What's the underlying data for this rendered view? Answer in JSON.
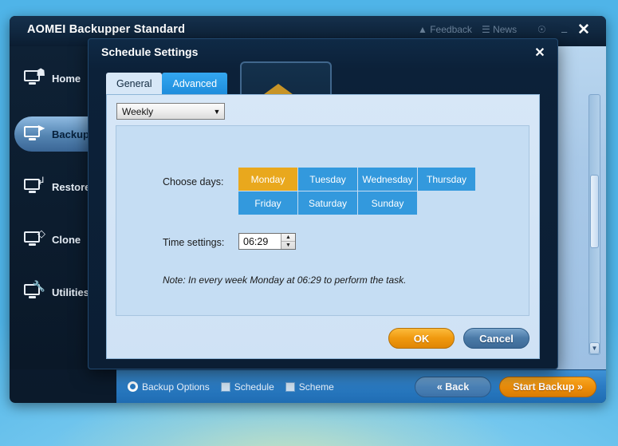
{
  "app": {
    "title": "AOMEI Backupper Standard",
    "close_label": "✕",
    "minimize_label": "–",
    "toolbar_icons": [
      "feedback-icon",
      "news-icon",
      "help-icon"
    ]
  },
  "sidebar": {
    "items": [
      {
        "label": "Home",
        "icon": "monitor-home-icon",
        "active": false
      },
      {
        "label": "Backup",
        "icon": "monitor-backup-icon",
        "active": true
      },
      {
        "label": "Restore",
        "icon": "monitor-restore-icon",
        "active": false
      },
      {
        "label": "Clone",
        "icon": "monitor-clone-icon",
        "active": false
      },
      {
        "label": "Utilities",
        "icon": "monitor-wrench-icon",
        "active": false
      }
    ]
  },
  "bottom_bar": {
    "backup_options": "Backup Options",
    "schedule": "Schedule",
    "scheme": "Scheme",
    "back": "« Back",
    "start_backup": "Start Backup »"
  },
  "dialog": {
    "title": "Schedule Settings",
    "close_label": "✕",
    "tabs": [
      {
        "label": "General",
        "active": true
      },
      {
        "label": "Advanced",
        "active": false
      }
    ],
    "frequency": {
      "value": "Weekly",
      "arrow": "▼"
    },
    "choose_days_label": "Choose days:",
    "days": [
      {
        "label": "Monday",
        "selected": true
      },
      {
        "label": "Tuesday",
        "selected": false
      },
      {
        "label": "Wednesday",
        "selected": false
      },
      {
        "label": "Thursday",
        "selected": false
      },
      {
        "label": "Friday",
        "selected": false
      },
      {
        "label": "Saturday",
        "selected": false
      },
      {
        "label": "Sunday",
        "selected": false
      }
    ],
    "time_label": "Time settings:",
    "time_value": "06:29",
    "spin_up": "▲",
    "spin_down": "▼",
    "note": "Note: In every week Monday at 06:29 to perform the task.",
    "ok": "OK",
    "cancel": "Cancel"
  },
  "colors": {
    "day_selected": "#e9a81d",
    "day_unselected": "#3399dd",
    "accent_orange": "#ee8e09",
    "dialog_body": "#d7e7f7",
    "panel": "#c5ddf3"
  }
}
